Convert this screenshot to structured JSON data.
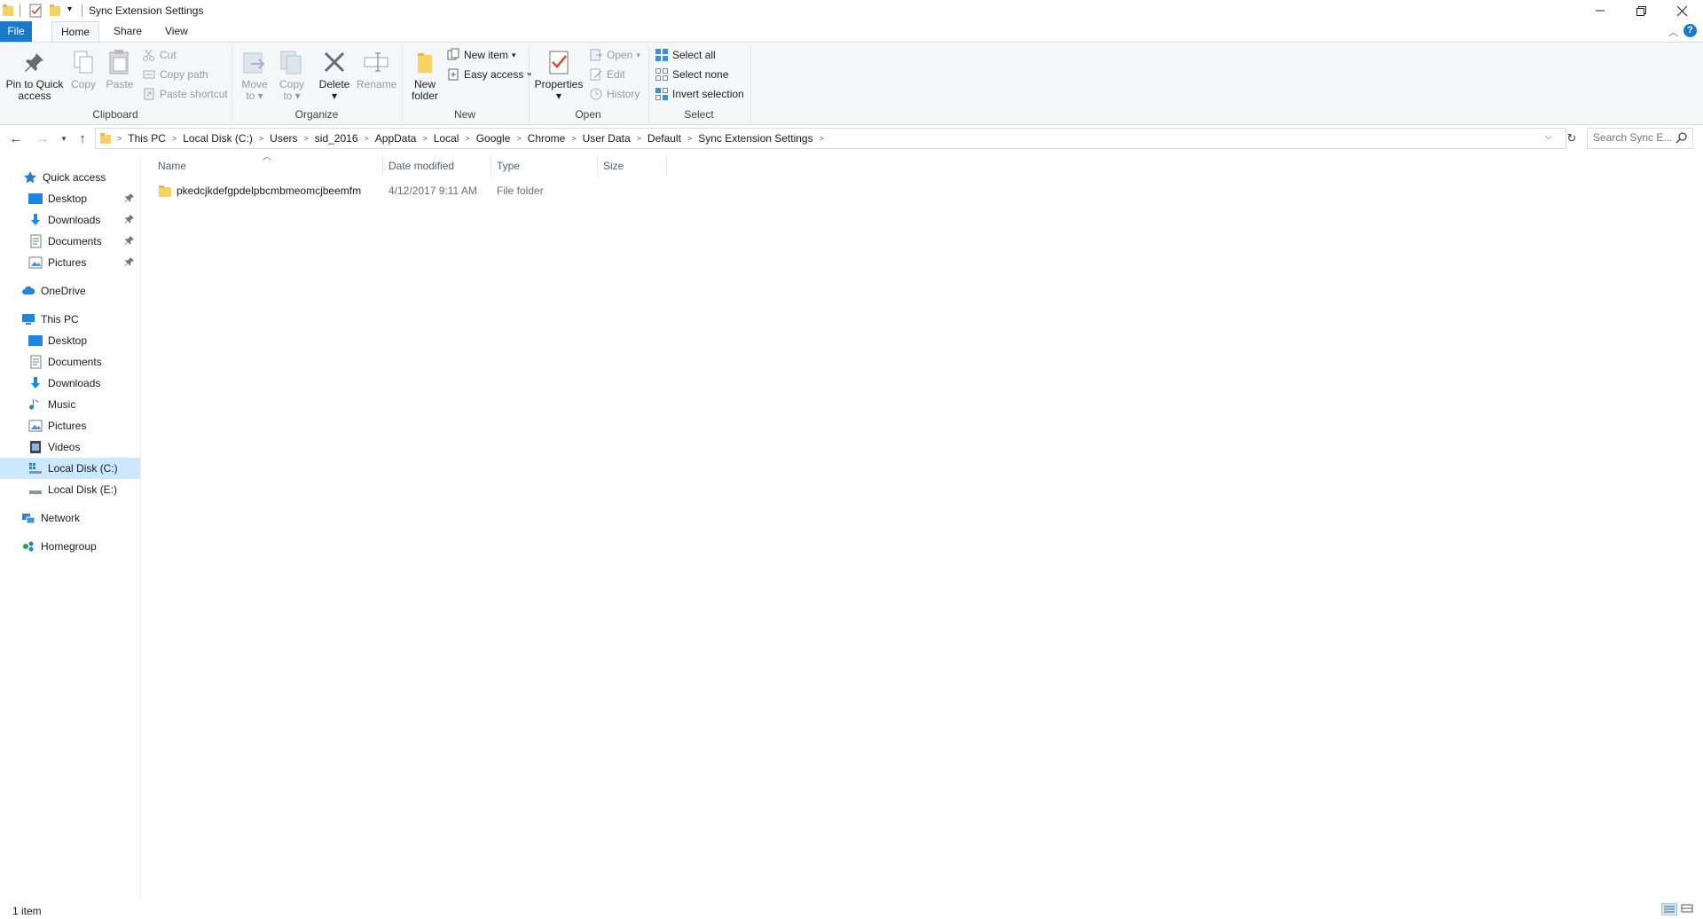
{
  "window": {
    "title": "Sync Extension Settings",
    "minimize_icon": "minimize-icon",
    "maximize_icon": "restore-icon",
    "close_icon": "close-icon"
  },
  "tabs": [
    {
      "label": "File"
    },
    {
      "label": "Home"
    },
    {
      "label": "Share"
    },
    {
      "label": "View"
    }
  ],
  "ribbon": {
    "clipboard": {
      "label": "Clipboard",
      "pin_label_1": "Pin to Quick",
      "pin_label_2": "access",
      "copy_label": "Copy",
      "paste_label": "Paste",
      "cut_label": "Cut",
      "copy_path_label": "Copy path",
      "paste_shortcut_label": "Paste shortcut"
    },
    "organize": {
      "label": "Organize",
      "move_to_1": "Move",
      "move_to_2": "to",
      "copy_to_1": "Copy",
      "copy_to_2": "to",
      "delete_label": "Delete",
      "rename_label": "Rename"
    },
    "new": {
      "label": "New",
      "new_folder_1": "New",
      "new_folder_2": "folder",
      "new_item_label": "New item",
      "easy_access_label": "Easy access"
    },
    "open": {
      "label": "Open",
      "properties_label": "Properties",
      "open_label": "Open",
      "edit_label": "Edit",
      "history_label": "History"
    },
    "select": {
      "label": "Select",
      "select_all_label": "Select all",
      "select_none_label": "Select none",
      "invert_label": "Invert selection"
    }
  },
  "address": {
    "crumbs": [
      "This PC",
      "Local Disk (C:)",
      "Users",
      "sid_2016",
      "AppData",
      "Local",
      "Google",
      "Chrome",
      "User Data",
      "Default",
      "Sync Extension Settings"
    ]
  },
  "search": {
    "placeholder": "Search Sync E..."
  },
  "navpane": {
    "quick_access": "Quick access",
    "qa_items": [
      "Desktop",
      "Downloads",
      "Documents",
      "Pictures"
    ],
    "onedrive": "OneDrive",
    "this_pc": "This PC",
    "pc_items": [
      "Desktop",
      "Documents",
      "Downloads",
      "Music",
      "Pictures",
      "Videos",
      "Local Disk (C:)",
      "Local Disk (E:)"
    ],
    "network": "Network",
    "homegroup": "Homegroup"
  },
  "columns": {
    "name": "Name",
    "date": "Date modified",
    "type": "Type",
    "size": "Size"
  },
  "files": [
    {
      "name": "pkedcjkdefgpdelpbcmbmeomcjbeemfm",
      "date": "4/12/2017 9:11 AM",
      "type": "File folder",
      "size": ""
    }
  ],
  "status": {
    "count": "1 item"
  },
  "colors": {
    "accent": "#1979ca",
    "selection": "#cce8ff",
    "folder": "#f7d260"
  }
}
